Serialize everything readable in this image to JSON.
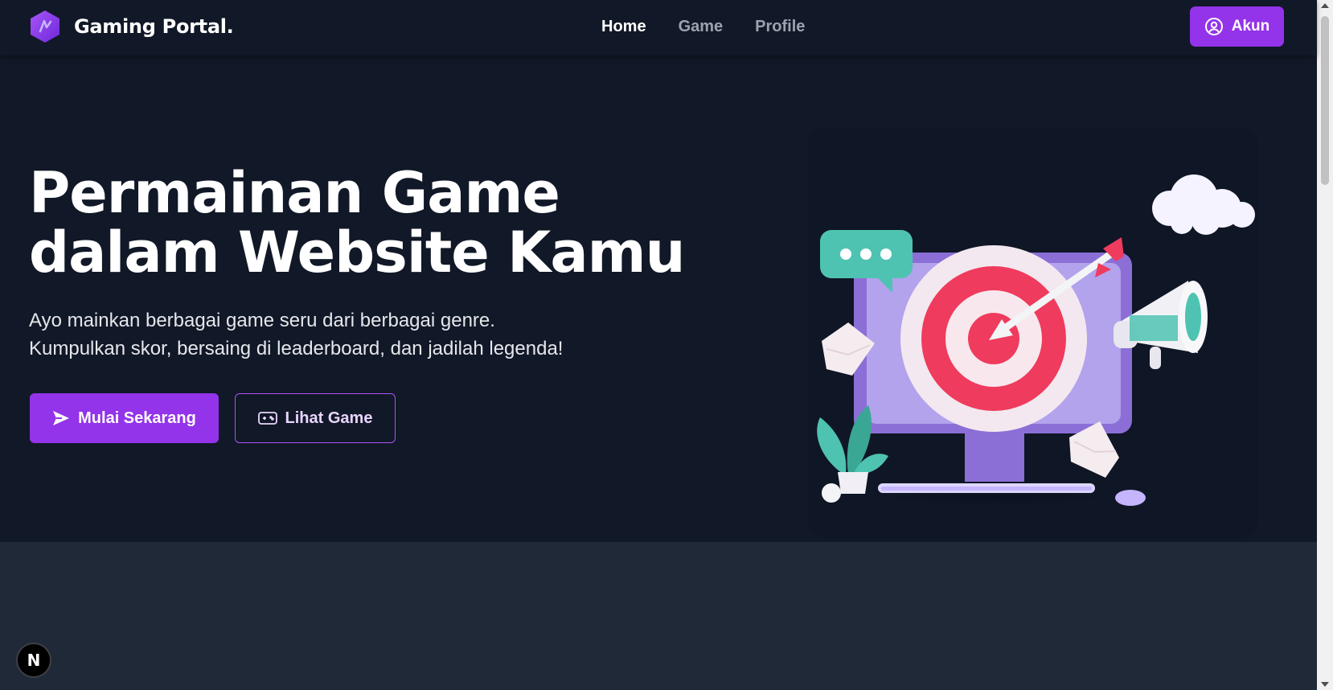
{
  "navbar": {
    "brand_name": "Gaming Portal.",
    "brand_logo_icon": "hexagon-bolt-logo",
    "links": [
      {
        "label": "Home",
        "active": true
      },
      {
        "label": "Game",
        "active": false
      },
      {
        "label": "Profile",
        "active": false
      }
    ],
    "account_button": {
      "label": "Akun",
      "icon": "user-circle-icon"
    }
  },
  "hero": {
    "title_line1": "Permainan Game",
    "title_line2": "dalam Website Kamu",
    "subtitle_line1": "Ayo mainkan berbagai game seru dari berbagai genre.",
    "subtitle_line2": "Kumpulkan skor, bersaing di leaderboard, dan jadilah legenda!",
    "primary_button": {
      "label": "Mulai Sekarang",
      "icon": "send-icon"
    },
    "secondary_button": {
      "label": "Lihat Game",
      "icon": "gamepad-icon"
    },
    "illustration": "monitor-target-arrow-illustration"
  },
  "dev_badge": {
    "label": "N",
    "icon": "nextjs-icon"
  },
  "colors": {
    "background": "#111827",
    "lower_section": "#1f2937",
    "accent": "#9333ea",
    "accent_border": "#a855f7",
    "muted_link": "#9ca3af"
  }
}
